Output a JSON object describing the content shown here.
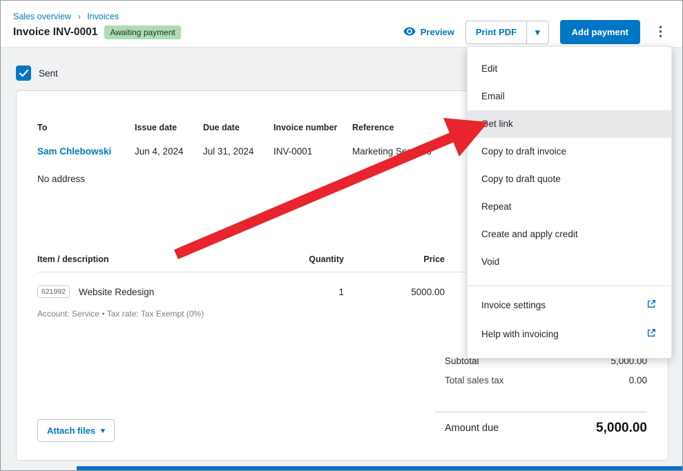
{
  "icons": {
    "breadcrumb_sep": "›",
    "caret_down": "▾",
    "kebab": "⋮"
  },
  "breadcrumb": {
    "items": [
      "Sales overview",
      "Invoices"
    ]
  },
  "header": {
    "title": "Invoice INV-0001",
    "status_badge": "Awaiting payment",
    "preview_label": "Preview",
    "print_pdf_label": "Print PDF",
    "add_payment_label": "Add payment"
  },
  "sent_checkbox_label": "Sent",
  "invoice": {
    "fields": [
      {
        "label": "To",
        "value": "Sam Chlebowski"
      },
      {
        "label": "Issue date",
        "value": "Jun 4, 2024"
      },
      {
        "label": "Due date",
        "value": "Jul 31, 2024"
      },
      {
        "label": "Invoice number",
        "value": "INV-0001"
      },
      {
        "label": "Reference",
        "value": "Marketing Services"
      }
    ],
    "no_address": "No address",
    "table": {
      "headers": {
        "description": "Item / description",
        "quantity": "Quantity",
        "price": "Price"
      },
      "row": {
        "code": "621992",
        "description": "Website Redesign",
        "quantity": "1",
        "price": "5000.00",
        "meta": "Account: Service • Tax rate: Tax Exempt (0%)"
      }
    },
    "totals": {
      "subtotal_label": "Subtotal",
      "subtotal_value": "5,000.00",
      "tax_label": "Total sales tax",
      "tax_value": "0.00",
      "amount_due_label": "Amount due",
      "amount_due_value": "5,000.00"
    },
    "attach_files_label": "Attach files"
  },
  "menu": {
    "items": [
      "Edit",
      "Email",
      "Get link",
      "Copy to draft invoice",
      "Copy to draft quote",
      "Repeat",
      "Create and apply credit",
      "Void"
    ],
    "highlighted_item": "Get link",
    "footer_items": [
      "Invoice settings",
      "Help with invoicing"
    ]
  },
  "colors": {
    "accent_blue": "#0077c5",
    "badge_green": "#aedcb2",
    "arrow_red": "#e8242c"
  }
}
